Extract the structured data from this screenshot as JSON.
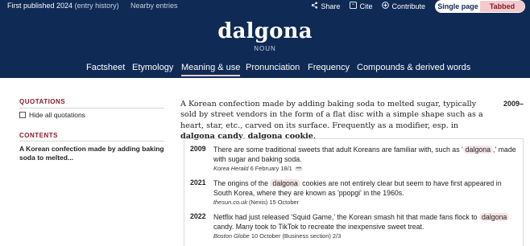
{
  "topbar": {
    "published": "First published 2024",
    "entry_history": "(entry history)",
    "nearby": "Nearby entries",
    "share": "Share",
    "cite": "Cite",
    "contribute": "Contribute",
    "view_single": "Single page",
    "view_tabbed": "Tabbed",
    "icons": {
      "share": "share-icon",
      "cite": "quote-icon",
      "contribute": "plus-icon"
    }
  },
  "entry": {
    "headword": "dalgona",
    "part_of_speech": "NOUN"
  },
  "nav": {
    "items": [
      "Factsheet",
      "Etymology",
      "Meaning & use",
      "Pronunciation",
      "Frequency",
      "Compounds & derived words"
    ],
    "active": "Meaning & use"
  },
  "sidebar": {
    "quotations_title": "QUOTATIONS",
    "hide_label": "Hide all quotations",
    "contents_title": "CONTENTS",
    "contents_link": "A Korean confection made by adding baking soda to melted..."
  },
  "definition": {
    "text_before": "A Korean confection made by adding baking soda to melted sugar, typically sold by street vendors in the form of a flat disc with a simple shape such as a heart, star, etc., carved on its surface. Frequently as a modifier, esp. in ",
    "term1": "dalgona candy",
    "sep": ", ",
    "term2": "dalgona cookie",
    "end": ".",
    "date_range": "2009–"
  },
  "quotations": [
    {
      "year": "2009",
      "before": "There are some traditional sweets that adult Koreans are familiar with, such as '",
      "highlight": "dalgona",
      "after": ",' made with sugar and baking soda.",
      "source_italic": "Korea Herald",
      "source_rest": " 6 February 18/1"
    },
    {
      "year": "2021",
      "before": "The origins of the ",
      "highlight": "dalgona",
      "after": " cookies are not entirely clear but seem to have first appeared in South Korea, where they are known as 'ppopgi' in the 1960s.",
      "source_italic": "thesun.co.uk",
      "source_rest": " (Nexis) 15 October"
    },
    {
      "year": "2022",
      "before": "Netflix had just released 'Squid Game,' the Korean smash hit that made fans flock to ",
      "highlight": "dalgona",
      "after": " candy. Many took to TikTok to recreate the inexpensive sweet treat.",
      "source_italic": "Boston Globe",
      "source_rest": " 10 October (Business section) 2/3"
    }
  ],
  "more_label": "•••",
  "colors": {
    "header_bg": "#0f2a55",
    "accent_red": "#8b1d2c",
    "highlight_pink": "#f5e4e6",
    "tab_pink": "#f4c9cc"
  }
}
